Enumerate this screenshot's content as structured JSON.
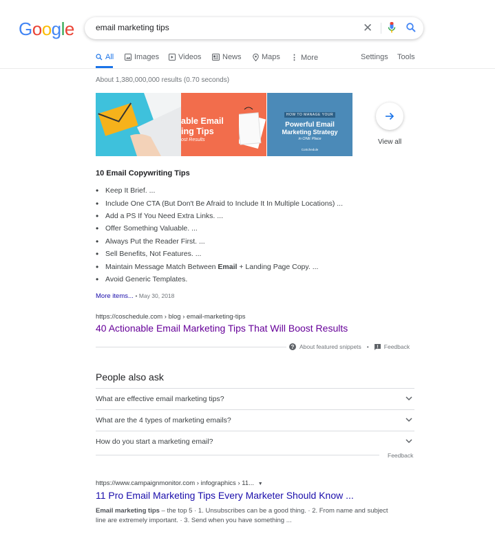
{
  "logo": {
    "letters": [
      "G",
      "o",
      "o",
      "g",
      "l",
      "e"
    ],
    "colors": [
      "#4285f4",
      "#ea4335",
      "#fbbc05",
      "#4285f4",
      "#34a853",
      "#ea4335"
    ]
  },
  "search": {
    "query": "email marketing tips"
  },
  "tabs": {
    "all": "All",
    "images": "Images",
    "videos": "Videos",
    "news": "News",
    "maps": "Maps",
    "more": "More",
    "settings": "Settings",
    "tools": "Tools"
  },
  "stats": "About 1,380,000,000 results (0.70 seconds)",
  "images": {
    "img2_text": [
      "able Email",
      "ing Tips",
      "ost Results"
    ],
    "img3_text": [
      "HOW TO MANAGE YOUR",
      "Powerful Email",
      "Marketing Strategy",
      "in ONE Place",
      "CoSchedule"
    ],
    "view_all": "View all"
  },
  "featured_snippet": {
    "title": "10 Email Copywriting Tips",
    "items": [
      "Keep It Brief. ...",
      "Include One CTA (But Don't Be Afraid to Include It In Multiple Locations) ...",
      "Add a PS If You Need Extra Links. ...",
      "Offer Something Valuable. ...",
      "Always Put the Reader First. ...",
      "Sell Benefits, Not Features. ...",
      "Maintain Message Match Between Email + Landing Page Copy. ...",
      "Avoid Generic Templates."
    ],
    "more_items": "More items...",
    "date": "• May 30, 2018",
    "cite": "https://coschedule.com › blog › email-marketing-tips",
    "link_title": "40 Actionable Email Marketing Tips That Will Boost Results",
    "about": "About featured snippets",
    "dot": "•",
    "feedback": "Feedback"
  },
  "paa": {
    "title": "People also ask",
    "questions": [
      "What are effective email marketing tips?",
      "What are the 4 types of marketing emails?",
      "How do you start a marketing email?"
    ],
    "feedback": "Feedback"
  },
  "result2": {
    "cite": "https://www.campaignmonitor.com › infographics › 11...",
    "title": "11 Pro Email Marketing Tips Every Marketer Should Know ...",
    "snippet_bold": "Email marketing tips",
    "snippet_rest": " – the top 5 · 1. Unsubscribes can be a good thing. · 2. From name and subject line are extremely important. · 3. Send when you have something ..."
  }
}
